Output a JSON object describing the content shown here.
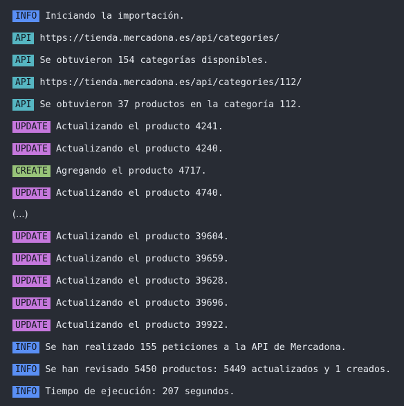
{
  "colors": {
    "background": "#282c34",
    "info": "#5a8ff5",
    "api": "#56b6c2",
    "update": "#c678dd",
    "create": "#98c379",
    "text": "#e6e9ee"
  },
  "log": [
    {
      "tag": "INFO",
      "text": "Iniciando la importación."
    },
    {
      "tag": "API",
      "text": "https://tienda.mercadona.es/api/categories/"
    },
    {
      "tag": "API",
      "text": "Se obtuvieron 154 categorías disponibles."
    },
    {
      "tag": "API",
      "text": "https://tienda.mercadona.es/api/categories/112/"
    },
    {
      "tag": "API",
      "text": "Se obtuvieron 37 productos en la categoría 112."
    },
    {
      "tag": "UPDATE",
      "text": "Actualizando el producto 4241."
    },
    {
      "tag": "UPDATE",
      "text": "Actualizando el producto 4240."
    },
    {
      "tag": "CREATE",
      "text": "Agregando el producto 4717."
    },
    {
      "tag": "UPDATE",
      "text": "Actualizando el producto 4740."
    },
    {
      "tag": "",
      "text": "(...)"
    },
    {
      "tag": "UPDATE",
      "text": "Actualizando el producto 39604."
    },
    {
      "tag": "UPDATE",
      "text": "Actualizando el producto 39659."
    },
    {
      "tag": "UPDATE",
      "text": "Actualizando el producto 39628."
    },
    {
      "tag": "UPDATE",
      "text": "Actualizando el producto 39696."
    },
    {
      "tag": "UPDATE",
      "text": "Actualizando el producto 39922."
    },
    {
      "tag": "INFO",
      "text": "Se han realizado 155 peticiones a la API de Mercadona."
    },
    {
      "tag": "INFO",
      "text": "Se han revisado 5450 productos: 5449 actualizados y 1 creados."
    },
    {
      "tag": "INFO",
      "text": "Tiempo de ejecución: 207 segundos."
    }
  ]
}
